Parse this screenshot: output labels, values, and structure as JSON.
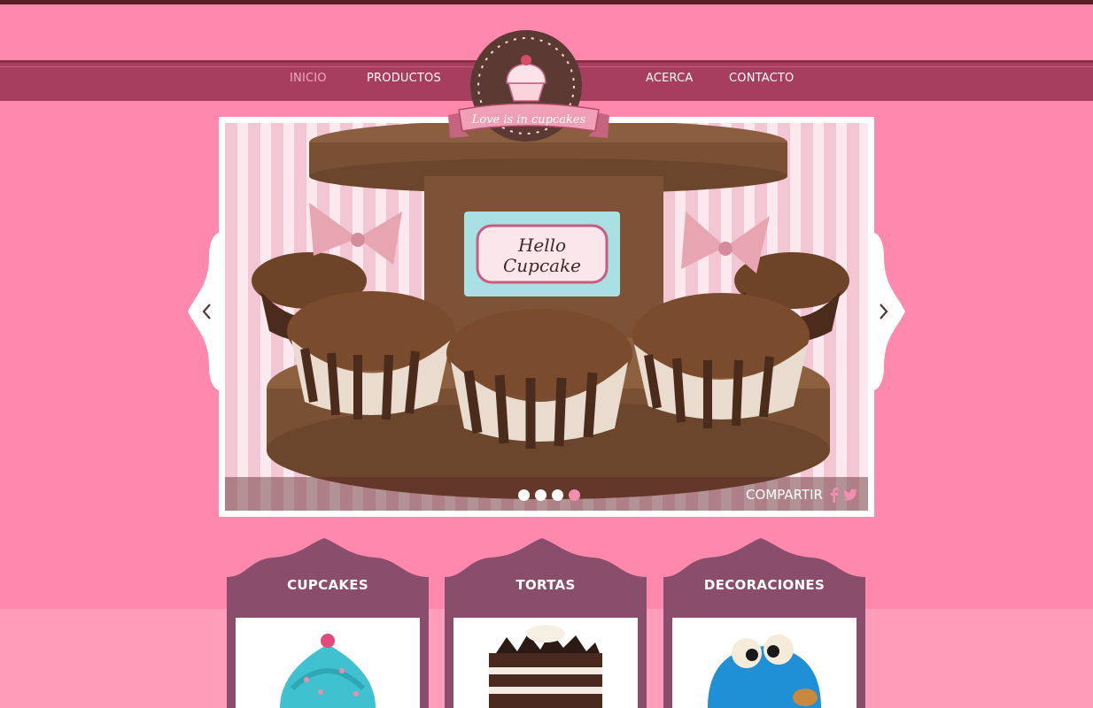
{
  "nav": {
    "items": [
      {
        "label": "INICIO",
        "active": true
      },
      {
        "label": "PRODUCTOS"
      },
      {
        "label": "ACERCA"
      },
      {
        "label": "CONTACTO"
      }
    ]
  },
  "logo": {
    "tagline": "Love is in cupcakes"
  },
  "slider": {
    "sign_text_line1": "Hello",
    "sign_text_line2": "Cupcake",
    "share_label": "COMPARTIR",
    "dots": 4,
    "active_dot": 4,
    "share_icons": [
      "facebook-icon",
      "twitter-icon"
    ],
    "prev_icon": "chevron-left-icon",
    "next_icon": "chevron-right-icon"
  },
  "categories": [
    {
      "title": "CUPCAKES"
    },
    {
      "title": "TORTAS"
    },
    {
      "title": "DECORACIONES"
    }
  ],
  "colors": {
    "background": "#ff89ae",
    "nav_band": "#a83e5f",
    "card": "#8a4e6c",
    "logo_brown": "#5a3a33",
    "active_nav": "#f5a9c2"
  }
}
